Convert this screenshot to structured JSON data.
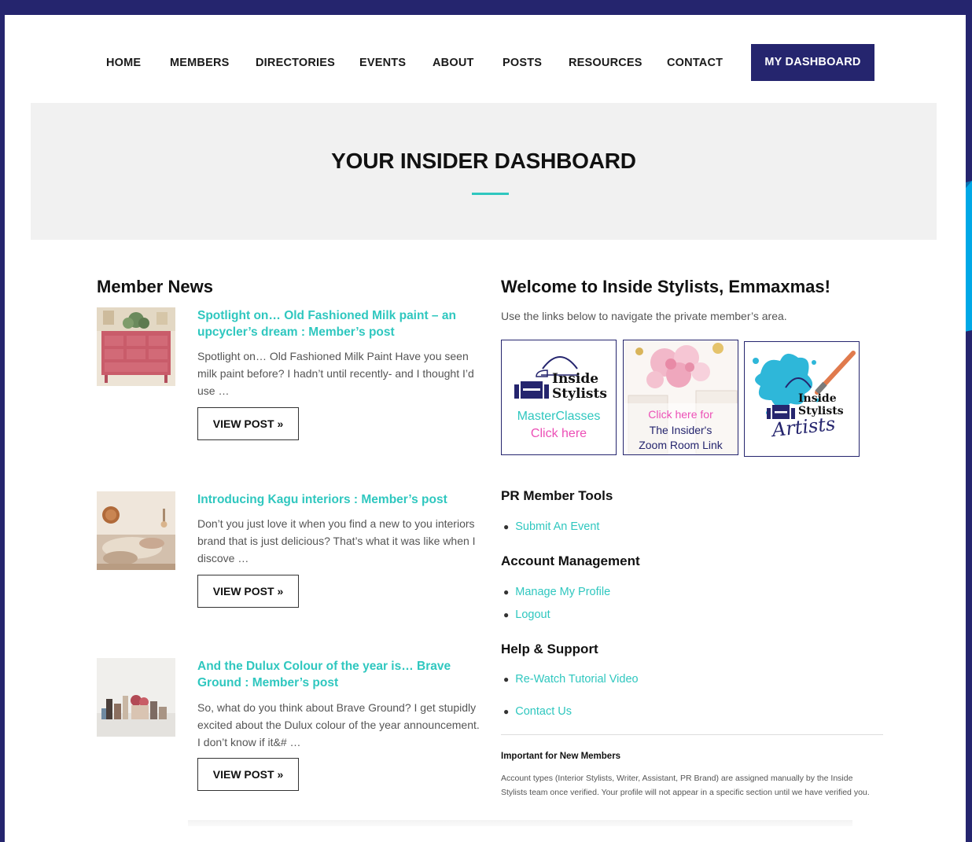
{
  "nav": {
    "items": [
      "HOME",
      "MEMBERS",
      "DIRECTORIES",
      "EVENTS",
      "ABOUT",
      "POSTS",
      "RESOURCES",
      "CONTACT"
    ],
    "dashboard_label": "MY DASHBOARD"
  },
  "hero": {
    "title": "YOUR INSIDER DASHBOARD"
  },
  "member_news": {
    "title": "Member News",
    "view_label": "VIEW POST »",
    "posts": [
      {
        "title": "Spotlight on… Old Fashioned Milk paint – an upcycler’s dream : Member’s post",
        "excerpt": "Spotlight on… Old Fashioned Milk Paint   Have you seen milk paint before? I hadn’t until recently- and I thought I’d use …"
      },
      {
        "title": "Introducing Kagu interiors : Member’s post",
        "excerpt": "Don’t you just love it when you find a new to you interiors brand that is just delicious? That’s what it was like when I discove …"
      },
      {
        "title": "And the Dulux Colour of the year is… Brave Ground : Member’s post",
        "excerpt": "So, what do you think about Brave Ground? I get stupidly excited about the Dulux colour of the year announcement. I don’t know if it&# …"
      }
    ]
  },
  "welcome": {
    "title": "Welcome to Inside Stylists, Emmaxmas!",
    "subtitle": "Use the links below to navigate the private member’s area.",
    "tiles": {
      "brand_line1": "Inside",
      "brand_line2": "Stylists",
      "masterclass_line1": "MasterClasses",
      "masterclass_line2": "Click here",
      "zoom_line1": "Click here for",
      "zoom_line2": "The Insider's",
      "zoom_line3": "Zoom  Room Link",
      "artists_script": "Artists"
    }
  },
  "pr_tools": {
    "heading": "PR Member Tools",
    "links": [
      "Submit An Event"
    ]
  },
  "account": {
    "heading": "Account Management",
    "links": [
      "Manage My Profile",
      "Logout"
    ]
  },
  "help": {
    "heading": "Help & Support",
    "links": [
      "Re-Watch Tutorial Video",
      "Contact Us"
    ]
  },
  "notice": {
    "heading": "Important for New Members",
    "body": "Account types (Interior Stylists, Writer, Assistant, PR Brand) are assigned manually by the Inside Stylists team once verified. Your profile will not appear in a specific section until we have verified you."
  },
  "colors": {
    "navy": "#25256e",
    "teal": "#2fc7bf",
    "pink": "#ec4fb6",
    "blue_accent": "#00a8e6"
  }
}
